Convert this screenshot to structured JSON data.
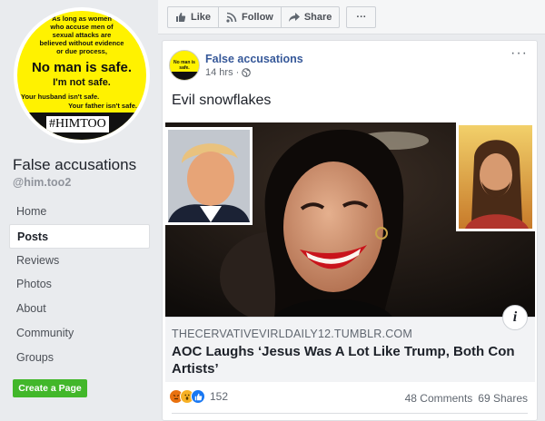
{
  "sidebar": {
    "profile_image": {
      "lines": [
        "As long as women",
        "who accuse men of",
        "sexual attacks are",
        "believed without evidence",
        "or due process,"
      ],
      "headline": "No man is safe.",
      "subhead": "I'm not safe.",
      "husband": "Your husband isn't safe.",
      "father": "Your father isn't safe.",
      "tag": "#HIMTOO"
    },
    "page_name": "False accusations",
    "handle": "@him.too2",
    "nav": [
      "Home",
      "Posts",
      "Reviews",
      "Photos",
      "About",
      "Community",
      "Groups"
    ],
    "active_nav": "Posts",
    "create_page": "Create a Page"
  },
  "toolbar": {
    "like": "Like",
    "follow": "Follow",
    "share": "Share",
    "more": "···"
  },
  "post": {
    "author": "False accusations",
    "time": "14 hrs ·",
    "privacy_icon": "globe-icon",
    "menu": "···",
    "text": "Evil snowflakes",
    "link": {
      "domain": "THECERVATIVEVIRLDAILY12.TUMBLR.COM",
      "title": "AOC Laughs ‘Jesus Was A Lot Like Trump, Both Con Artists’",
      "info": "i"
    },
    "reactions": {
      "icons": [
        "angry-icon",
        "wow-icon",
        "like-icon"
      ],
      "count": "152"
    },
    "comments": "48 Comments",
    "shares": "69 Shares"
  },
  "colors": {
    "background": "#e9ebee",
    "link": "#365899",
    "create_button": "#42b72a",
    "profile_yellow": "#fff200"
  }
}
